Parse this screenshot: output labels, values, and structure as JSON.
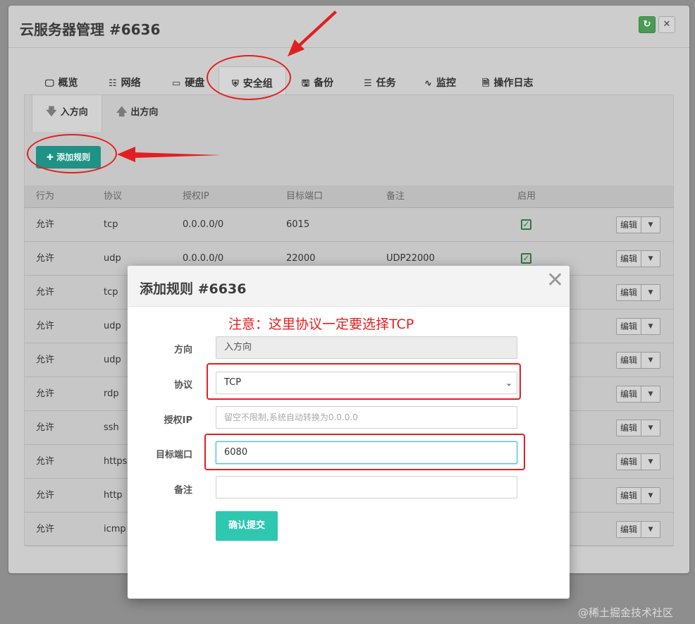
{
  "window": {
    "title": "云服务器管理 #6636",
    "refresh_icon": "refresh-icon",
    "close_icon": "close-icon"
  },
  "tabs": [
    {
      "label": "概览",
      "icon": "monitor-icon"
    },
    {
      "label": "网络",
      "icon": "network-icon"
    },
    {
      "label": "硬盘",
      "icon": "disk-icon"
    },
    {
      "label": "安全组",
      "icon": "shield-icon",
      "active": true
    },
    {
      "label": "备份",
      "icon": "save-icon"
    },
    {
      "label": "任务",
      "icon": "task-list-icon"
    },
    {
      "label": "监控",
      "icon": "pulse-icon"
    },
    {
      "label": "操作日志",
      "icon": "document-icon"
    }
  ],
  "direction_tabs": {
    "inbound": "入方向",
    "outbound": "出方向"
  },
  "add_rule_button": "添加规则",
  "table": {
    "headers": {
      "action": "行为",
      "protocol": "协议",
      "ip": "授权IP",
      "port": "目标端口",
      "note": "备注",
      "enabled": "启用"
    },
    "rows": [
      {
        "action": "允许",
        "protocol": "tcp",
        "ip": "0.0.0.0/0",
        "port": "6015",
        "note": ""
      },
      {
        "action": "允许",
        "protocol": "udp",
        "ip": "0.0.0.0/0",
        "port": "22000",
        "note": "UDP22000"
      },
      {
        "action": "允许",
        "protocol": "tcp"
      },
      {
        "action": "允许",
        "protocol": "udp"
      },
      {
        "action": "允许",
        "protocol": "udp"
      },
      {
        "action": "允许",
        "protocol": "rdp"
      },
      {
        "action": "允许",
        "protocol": "ssh"
      },
      {
        "action": "允许",
        "protocol": "https"
      },
      {
        "action": "允许",
        "protocol": "http"
      },
      {
        "action": "允许",
        "protocol": "icmp"
      }
    ],
    "edit_label": "编辑"
  },
  "modal": {
    "title": "添加规则 #6636",
    "note": "注意：这里协议一定要选择TCP",
    "fields": {
      "direction": {
        "label": "方向",
        "value": "入方向"
      },
      "protocol": {
        "label": "协议",
        "value": "TCP"
      },
      "ip": {
        "label": "授权IP",
        "placeholder": "留空不限制,系统自动转换为0.0.0.0"
      },
      "port": {
        "label": "目标端口",
        "value": "6080"
      },
      "remark": {
        "label": "备注",
        "value": ""
      }
    },
    "submit": "确认提交"
  },
  "watermark": "@稀土掘金技术社区",
  "colors": {
    "annotation_red": "#e02020",
    "submit_teal": "#2ec8b1",
    "add_button_teal": "#1f9185"
  }
}
